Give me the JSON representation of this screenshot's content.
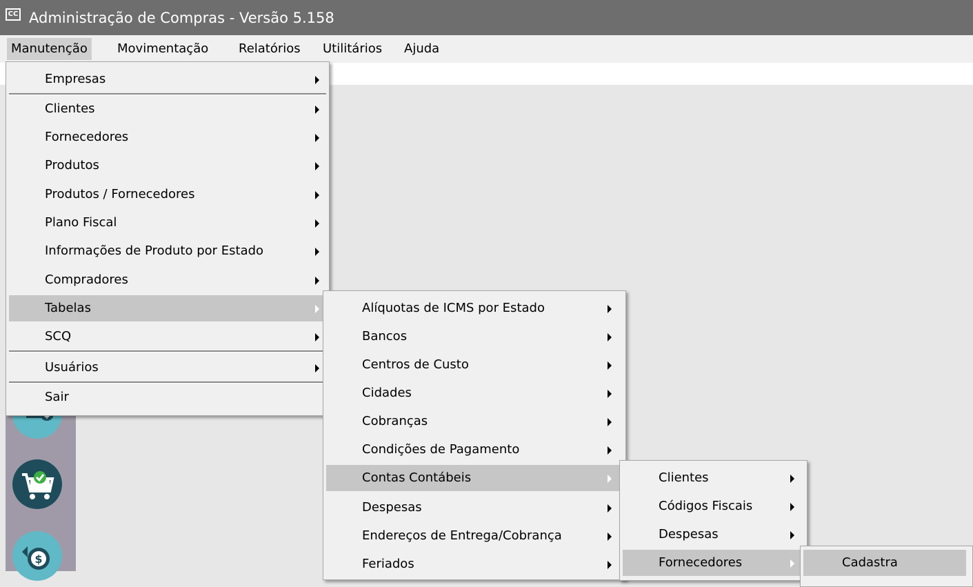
{
  "window": {
    "app_icon": "CC",
    "title": "Administração de Compras - Versão 5.158"
  },
  "menubar": {
    "items": [
      {
        "label": "Manutenção"
      },
      {
        "label": "Movimentação"
      },
      {
        "label": "Relatórios"
      },
      {
        "label": "Utilitários"
      },
      {
        "label": "Ajuda"
      }
    ]
  },
  "menu_manutencao": {
    "items": [
      {
        "label": "Empresas"
      },
      {
        "label": "Clientes"
      },
      {
        "label": "Fornecedores"
      },
      {
        "label": "Produtos"
      },
      {
        "label": "Produtos / Fornecedores"
      },
      {
        "label": "Plano Fiscal"
      },
      {
        "label": "Informações de Produto por Estado"
      },
      {
        "label": "Compradores"
      },
      {
        "label": "Tabelas"
      },
      {
        "label": "SCQ"
      },
      {
        "label": "Usuários"
      },
      {
        "label": "Sair"
      }
    ]
  },
  "menu_tabelas": {
    "items": [
      {
        "label": "Alíquotas de ICMS por Estado"
      },
      {
        "label": "Bancos"
      },
      {
        "label": "Centros de Custo"
      },
      {
        "label": "Cidades"
      },
      {
        "label": "Cobranças"
      },
      {
        "label": "Condições de Pagamento"
      },
      {
        "label": "Contas Contábeis"
      },
      {
        "label": "Despesas"
      },
      {
        "label": "Endereços de Entrega/Cobrança"
      },
      {
        "label": "Feriados"
      }
    ]
  },
  "menu_contas": {
    "items": [
      {
        "label": "Clientes"
      },
      {
        "label": "Códigos Fiscais"
      },
      {
        "label": "Despesas"
      },
      {
        "label": "Fornecedores"
      }
    ]
  },
  "menu_fornecedores": {
    "items": [
      {
        "label": "Cadastra"
      }
    ]
  },
  "toolbar_icons": [
    "money-transfer-icon",
    "cart-check-icon",
    "dollar-refresh-icon"
  ]
}
